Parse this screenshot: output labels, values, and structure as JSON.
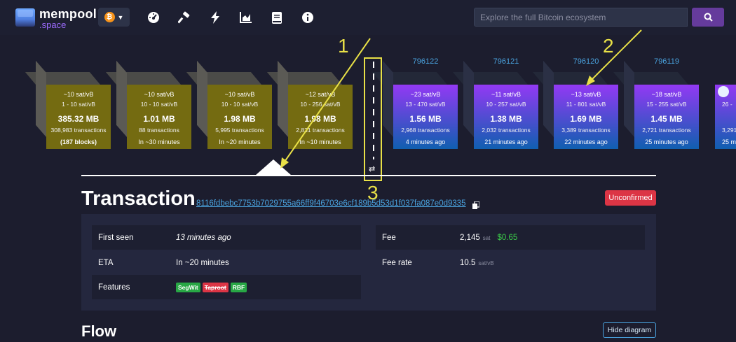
{
  "logo": {
    "line1": "mempool",
    "line2": ".space"
  },
  "network": {
    "coin_symbol": "₿"
  },
  "search": {
    "placeholder": "Explore the full Bitcoin ecosystem"
  },
  "nav_icons": [
    "dashboard-icon",
    "hammer-icon",
    "lightning-icon",
    "chart-icon",
    "book-icon",
    "info-icon"
  ],
  "mempool_blocks": [
    {
      "fee": "~10 sat/vB",
      "range": "1 - 10 sat/vB",
      "size": "385.32 MB",
      "txs": "308,983 transactions",
      "time": "(187 blocks)"
    },
    {
      "fee": "~10 sat/vB",
      "range": "10 - 10 sat/vB",
      "size": "1.01 MB",
      "txs": "88 transactions",
      "time": "In ~30 minutes"
    },
    {
      "fee": "~10 sat/vB",
      "range": "10 - 10 sat/vB",
      "size": "1.98 MB",
      "txs": "5,995 transactions",
      "time": "In ~20 minutes"
    },
    {
      "fee": "~12 sat/vB",
      "range": "10 - 256 sat/vB",
      "size": "1.98 MB",
      "txs": "2,831 transactions",
      "time": "In ~10 minutes"
    }
  ],
  "mined_blocks": [
    {
      "height": "796122",
      "fee": "~23 sat/vB",
      "range": "13 - 470 sat/vB",
      "size": "1.56 MB",
      "txs": "2,968 transactions",
      "time": "4 minutes ago"
    },
    {
      "height": "796121",
      "fee": "~11 sat/vB",
      "range": "10 - 257 sat/vB",
      "size": "1.38 MB",
      "txs": "2,032 transactions",
      "time": "21 minutes ago"
    },
    {
      "height": "796120",
      "fee": "~13 sat/vB",
      "range": "11 - 801 sat/vB",
      "size": "1.69 MB",
      "txs": "3,389 transactions",
      "time": "22 minutes ago"
    },
    {
      "height": "796119",
      "fee": "~18 sat/vB",
      "range": "15 - 255 sat/vB",
      "size": "1.45 MB",
      "txs": "2,721 transactions",
      "time": "25 minutes ago"
    },
    {
      "height": "",
      "fee": "",
      "range": "26 -",
      "size": "",
      "txs": "3,291",
      "time": "25 m"
    }
  ],
  "annotations": [
    "1",
    "2",
    "3"
  ],
  "transaction": {
    "title": "Transaction",
    "txid": "8116fdbebc7753b7029755a66ff9f46703e6cf189b5d53d1f037fa087e0d9335",
    "status": "Unconfirmed",
    "first_seen_label": "First seen",
    "first_seen_value": "13 minutes ago",
    "eta_label": "ETA",
    "eta_value": "In ~20 minutes",
    "features_label": "Features",
    "features": [
      "SegWit",
      "Taproot",
      "RBF"
    ],
    "fee_label": "Fee",
    "fee_value": "2,145",
    "fee_unit": "sat",
    "fee_usd": "$0.65",
    "feerate_label": "Fee rate",
    "feerate_value": "10.5",
    "feerate_unit": "sat/vB"
  },
  "flow": {
    "title": "Flow",
    "hide_button": "Hide diagram"
  },
  "colors": {
    "accent": "#653b9c",
    "link": "#4aa3df",
    "annotation": "#e8e047",
    "unconfirmed": "#dc3545",
    "success": "#3bcc49"
  }
}
